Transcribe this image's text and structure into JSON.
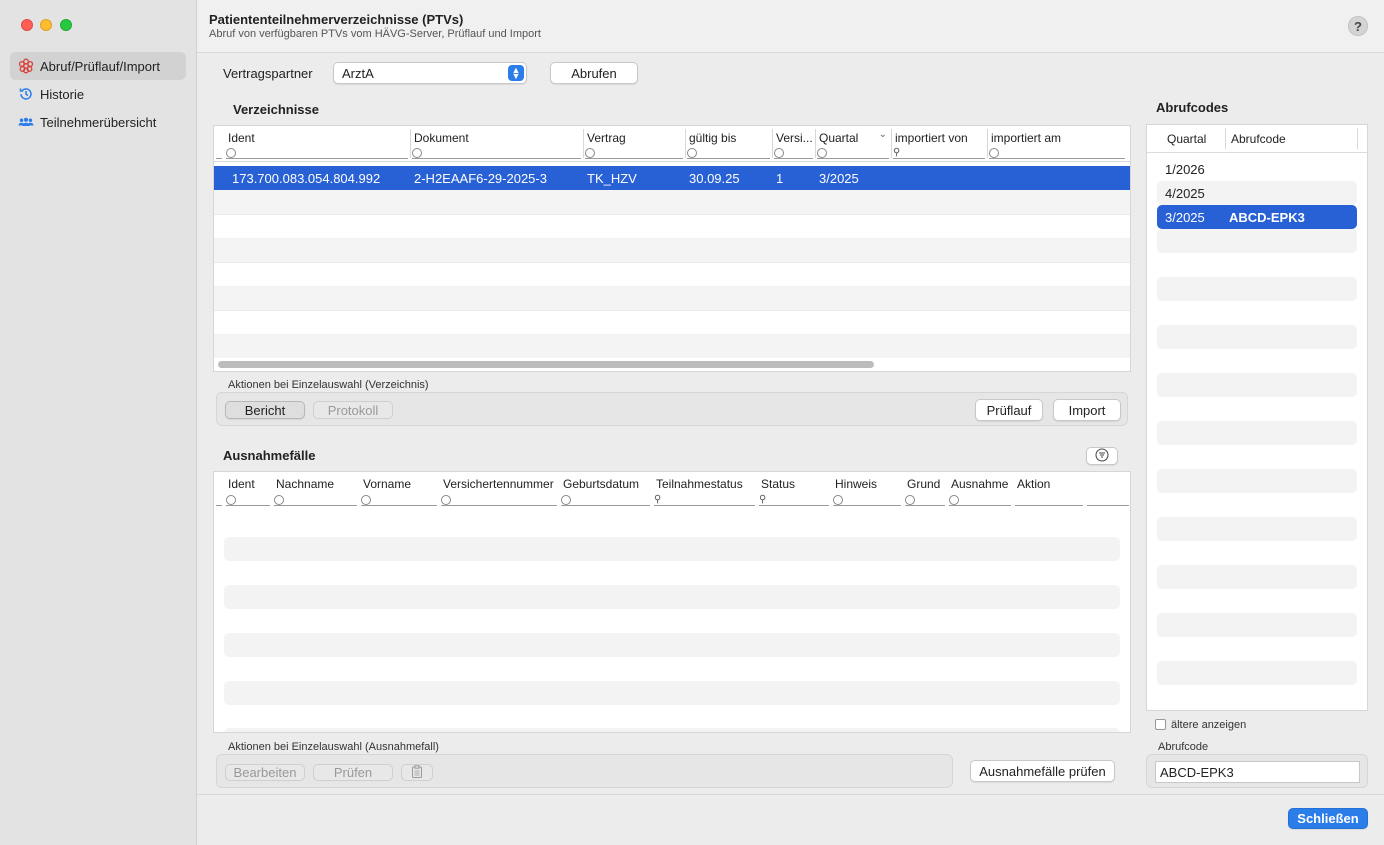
{
  "window": {
    "title": "Patiententeilnehmerverzeichnisse (PTVs)",
    "subtitle": "Abruf von verfügbaren PTVs vom HÄVG-Server, Prüflauf und Import",
    "help": "?"
  },
  "sidebar": {
    "items": [
      {
        "label": "Abruf/Prüflauf/Import",
        "icon": "gear-flower-icon",
        "active": true
      },
      {
        "label": "Historie",
        "icon": "history-icon",
        "active": false
      },
      {
        "label": "Teilnehmerübersicht",
        "icon": "people-icon",
        "active": false
      }
    ]
  },
  "vertragspartner": {
    "label": "Vertragspartner",
    "selected": "ArztA",
    "fetch_button": "Abrufen"
  },
  "verzeichnisse": {
    "title": "Verzeichnisse",
    "columns": [
      "Ident",
      "Dokument",
      "Vertrag",
      "gültig bis",
      "Versi...",
      "Quartal",
      "importiert von",
      "importiert am"
    ],
    "rows": [
      {
        "ident": "173.700.083.054.804.992",
        "dokument": "2-H2EAAF6-29-2025-3",
        "vertrag": "TK_HZV",
        "gueltig": "30.09.25",
        "version": "1",
        "quartal": "3/2025",
        "von": "",
        "am": ""
      }
    ],
    "actions_label": "Aktionen bei Einzelauswahl (Verzeichnis)",
    "bericht": "Bericht",
    "protokoll": "Protokoll",
    "prueflauf": "Prüflauf",
    "import": "Import"
  },
  "ausnahmen": {
    "title": "Ausnahmefälle",
    "columns": [
      "Ident",
      "Nachname",
      "Vorname",
      "Versichertennummer",
      "Geburtsdatum",
      "Teilnahmestatus",
      "Status",
      "Hinweis",
      "Grund",
      "Ausnahme",
      "Aktion"
    ],
    "actions_label": "Aktionen bei Einzelauswahl (Ausnahmefall)",
    "bearbeiten": "Bearbeiten",
    "pruefen": "Prüfen",
    "check_all": "Ausnahmefälle prüfen"
  },
  "abrufcodes": {
    "title": "Abrufcodes",
    "columns": [
      "Quartal",
      "Abrufcode"
    ],
    "rows": [
      {
        "quartal": "1/2026",
        "code": ""
      },
      {
        "quartal": "4/2025",
        "code": ""
      },
      {
        "quartal": "3/2025",
        "code": "ABCD-EPK3"
      }
    ],
    "older_label": "ältere anzeigen",
    "field_label": "Abrufcode",
    "field_value": "ABCD-EPK3"
  },
  "footer": {
    "close": "Schließen"
  },
  "colors": {
    "accent": "#2b7de9",
    "selection": "#2860d6",
    "close_red": "#fe5f57",
    "min_yellow": "#febc2e",
    "max_green": "#28c840"
  }
}
